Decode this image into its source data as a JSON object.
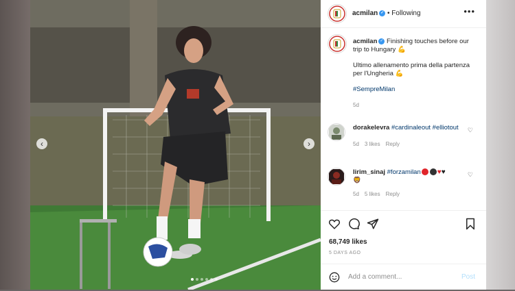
{
  "post": {
    "username": "acmilan",
    "follow_status": "Following",
    "separator": "•",
    "caption_line1": "Finishing touches before our trip to Hungary",
    "caption_line2": "Ultimo allenamento prima della partenza per l'Ungheria",
    "hashtag": "#SempreMilan",
    "caption_time": "5d"
  },
  "comments": [
    {
      "username": "dorakelevra",
      "text": "#cardinaleout #elliotout",
      "time": "5d",
      "likes": "3 likes",
      "reply": "Reply"
    },
    {
      "username": "lirim_sinaj",
      "text": "#forzamilan",
      "time": "5d",
      "likes": "5 likes",
      "reply": "Reply"
    }
  ],
  "stats": {
    "likes": "68,749 likes",
    "date": "5 DAYS AGO"
  },
  "composer": {
    "placeholder": "Add a comment...",
    "post_label": "Post"
  },
  "carousel": {
    "total": 6,
    "active_index": 0
  },
  "icons": {
    "prev": "chevron-left-icon",
    "next": "chevron-right-icon",
    "more": "more-options-icon",
    "like": "heart-icon",
    "comment": "comment-icon",
    "share": "share-icon",
    "save": "bookmark-icon",
    "emoji": "emoji-icon"
  },
  "colors": {
    "link": "#00376b",
    "verified": "#3897f0",
    "muted": "#8e8e8e",
    "post_disabled": "#b2dffc"
  }
}
